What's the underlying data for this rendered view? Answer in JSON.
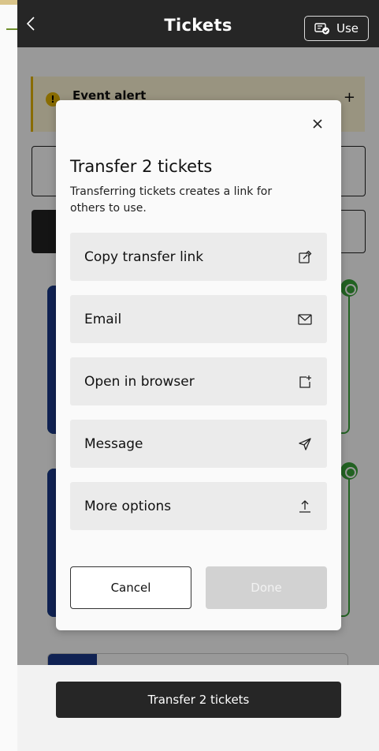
{
  "header": {
    "title": "Tickets",
    "use_label": "Use"
  },
  "alert": {
    "title": "Event alert",
    "expand_symbol": "+"
  },
  "bottom": {
    "transfer_label": "Transfer 2 tickets"
  },
  "modal": {
    "title": "Transfer 2 tickets",
    "description": "Transferring tickets creates a link for others to use.",
    "close_symbol": "×",
    "options": [
      {
        "label": "Copy transfer link",
        "icon": "copy-link-icon"
      },
      {
        "label": "Email",
        "icon": "mail-icon"
      },
      {
        "label": "Open in browser",
        "icon": "open-external-icon"
      },
      {
        "label": "Message",
        "icon": "send-icon"
      },
      {
        "label": "More options",
        "icon": "share-upload-icon"
      }
    ],
    "cancel_label": "Cancel",
    "done_label": "Done"
  },
  "colors": {
    "header_bg": "#262626",
    "alert_accent": "#e4b400",
    "ticket_border": "#3aa33a",
    "ticket_stub": "#1b3a8a",
    "disabled_button": "#d2d2d2"
  }
}
